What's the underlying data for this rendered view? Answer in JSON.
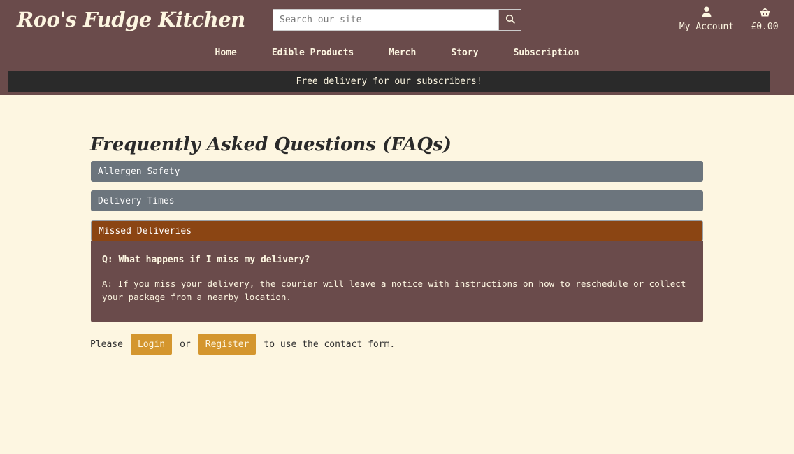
{
  "header": {
    "logo": "Roo's Fudge Kitchen",
    "search": {
      "placeholder": "Search our site"
    },
    "account_label": "My Account",
    "basket_total": "£0.00"
  },
  "nav": {
    "items": [
      {
        "label": "Home"
      },
      {
        "label": "Edible Products"
      },
      {
        "label": "Merch"
      },
      {
        "label": "Story"
      },
      {
        "label": "Subscription"
      }
    ]
  },
  "banner": "Free delivery for our subscribers!",
  "faq": {
    "title": "Frequently Asked Questions (FAQs)",
    "items": [
      {
        "label": "Allergen Safety",
        "expanded": false
      },
      {
        "label": "Delivery Times",
        "expanded": false
      },
      {
        "label": "Missed Deliveries",
        "expanded": true
      }
    ],
    "open_answer": {
      "question": "Q: What happens if I miss my delivery?",
      "answer": "A: If you miss your delivery, the courier will leave a notice with instructions on how to reschedule or collect your package from a nearby location."
    }
  },
  "contact": {
    "prefix": "Please",
    "login_label": "Login",
    "or": "or",
    "register_label": "Register",
    "suffix": "to use the contact form."
  },
  "colors": {
    "header_bg": "#6a4b4b",
    "page_bg": "#fdf6e1",
    "accordion_closed": "#6c757d",
    "accordion_open": "#8b4513",
    "button_bg": "#d4962e"
  }
}
